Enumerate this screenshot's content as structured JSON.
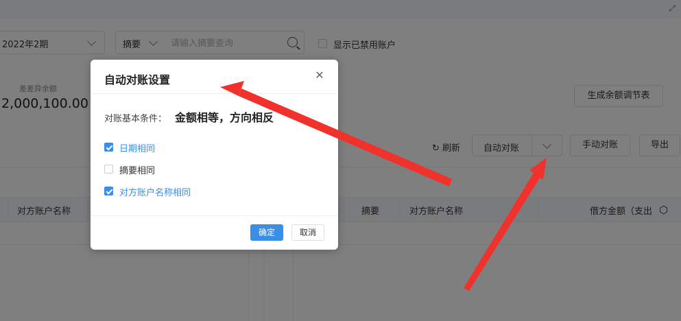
{
  "toolbar": {
    "period": "2022年2期",
    "search_type": "摘要",
    "search_placeholder": "请输入摘要查询",
    "show_disabled_label": "显示已禁用账户"
  },
  "summary": {
    "diff_label": "差差异余额",
    "diff_value": "2,000,100.00",
    "generate_button": "生成余额调节表"
  },
  "actions": {
    "refresh": "刷新",
    "auto_reconcile": "自动对账",
    "manual_reconcile": "手动对账",
    "export": "导出"
  },
  "table": {
    "left_columns": [
      "对方账户名称"
    ],
    "right_columns": [
      "摘要",
      "对方账户名称",
      "借方金额（支出"
    ]
  },
  "dialog": {
    "title": "自动对账设置",
    "condition_label": "对账基本条件：",
    "condition_value": "金额相等，方向相反",
    "options": [
      {
        "label": "日期相同",
        "checked": true
      },
      {
        "label": "摘要相同",
        "checked": false
      },
      {
        "label": "对方账户名称相同",
        "checked": true
      }
    ],
    "ok": "确定",
    "cancel": "取消"
  },
  "annotations": {
    "arrow_color": "#f0312c"
  }
}
